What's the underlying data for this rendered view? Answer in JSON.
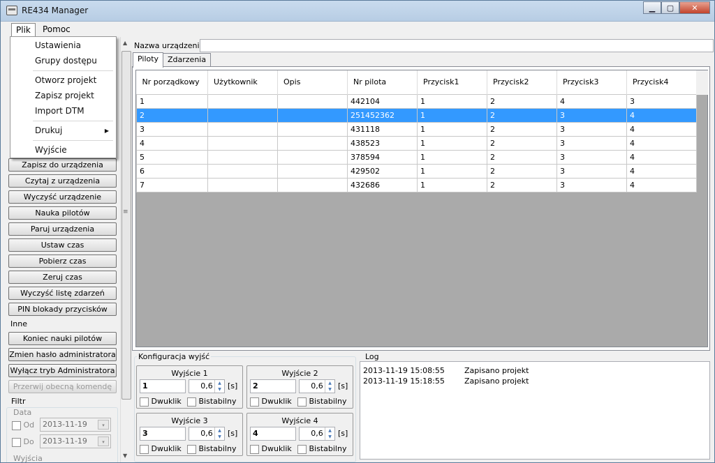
{
  "window": {
    "title": "RE434 Manager"
  },
  "menubar": {
    "file": "Plik",
    "help": "Pomoc"
  },
  "file_menu": {
    "settings": "Ustawienia",
    "access_groups": "Grupy dostępu",
    "open_project": "Otworz projekt",
    "save_project": "Zapisz projekt",
    "import_dtm": "Import DTM",
    "print": "Drukuj",
    "exit": "Wyjście"
  },
  "left_panel": {
    "buttons": [
      "Zapisz do urządzenia",
      "Czytaj z urządzenia",
      "Wyczyść urządzenie",
      "Nauka pilotów",
      "Paruj urządzenia",
      "Ustaw czas",
      "Pobierz czas",
      "Zeruj czas",
      "Wyczyść listę zdarzeń",
      "PIN blokady przycisków"
    ],
    "other_label": "Inne",
    "other_buttons": [
      "Koniec nauki pilotów",
      "Zmien hasło administratora",
      "Wyłącz tryb Administratora",
      "Przerwij obecną komendę"
    ],
    "filter_label": "Filtr",
    "date_label": "Data",
    "from_label": "Od",
    "to_label": "Do",
    "from_date": "2013-11-19",
    "to_date": "2013-11-19",
    "outputs_label": "Wyjścia"
  },
  "device_name": {
    "label": "Nazwa urządzenia:",
    "value": ""
  },
  "tabs": {
    "pilots": "Piloty",
    "events": "Zdarzenia"
  },
  "grid": {
    "headers": [
      "Nr porządkowy",
      "Użytkownik",
      "Opis",
      "Nr pilota",
      "Przycisk1",
      "Przycisk2",
      "Przycisk3",
      "Przycisk4"
    ],
    "rows": [
      [
        "1",
        "",
        "",
        "442104",
        "1",
        "2",
        "4",
        "3"
      ],
      [
        "2",
        "",
        "",
        "251452362",
        "1",
        "2",
        "3",
        "4"
      ],
      [
        "3",
        "",
        "",
        "431118",
        "1",
        "2",
        "3",
        "4"
      ],
      [
        "4",
        "",
        "",
        "438523",
        "1",
        "2",
        "3",
        "4"
      ],
      [
        "5",
        "",
        "",
        "378594",
        "1",
        "2",
        "3",
        "4"
      ],
      [
        "6",
        "",
        "",
        "429502",
        "1",
        "2",
        "3",
        "4"
      ],
      [
        "7",
        "",
        "",
        "432686",
        "1",
        "2",
        "3",
        "4"
      ]
    ],
    "selected_row": 1
  },
  "outputs_config": {
    "label": "Konfiguracja wyjść",
    "outputs": [
      {
        "title": "Wyjście 1",
        "number": "1",
        "value": "0,6",
        "unit": "[s]",
        "dbl": "Dwuklik",
        "bi": "Bistabilny"
      },
      {
        "title": "Wyjście 2",
        "number": "2",
        "value": "0,6",
        "unit": "[s]",
        "dbl": "Dwuklik",
        "bi": "Bistabilny"
      },
      {
        "title": "Wyjście 3",
        "number": "3",
        "value": "0,6",
        "unit": "[s]",
        "dbl": "Dwuklik",
        "bi": "Bistabilny"
      },
      {
        "title": "Wyjście 4",
        "number": "4",
        "value": "0,6",
        "unit": "[s]",
        "dbl": "Dwuklik",
        "bi": "Bistabilny"
      }
    ]
  },
  "log": {
    "label": "Log",
    "entries": [
      {
        "date": "2013-11-19 15:08:55",
        "msg": "Zapisano projekt"
      },
      {
        "date": "2013-11-19 15:18:55",
        "msg": "Zapisano projekt"
      }
    ]
  }
}
